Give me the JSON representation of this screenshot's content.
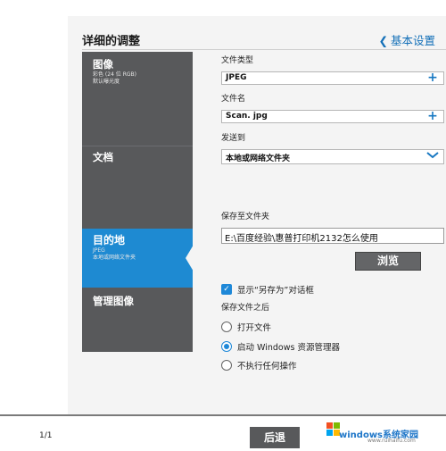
{
  "header": {
    "title": "详细的调整",
    "back_label": "基本设置",
    "back_chevron": "❮"
  },
  "sidebar": {
    "items": [
      {
        "title": "图像",
        "sub1": "彩色 (24 位 RGB)",
        "sub2": "默认曝光度"
      },
      {
        "title": "文档",
        "sub1": "",
        "sub2": ""
      },
      {
        "title": "目的地",
        "sub1": "JPEG",
        "sub2": "本地或网络文件夹"
      },
      {
        "title": "管理图像",
        "sub1": "",
        "sub2": ""
      }
    ],
    "active_index": 2
  },
  "form": {
    "file_type_label": "文件类型",
    "file_type_value": "JPEG",
    "file_name_label": "文件名",
    "file_name_value": "Scan. jpg",
    "send_to_label": "发送到",
    "send_to_value": "本地或网络文件夹",
    "save_folder_label": "保存至文件夹",
    "save_folder_path": "E:\\百度经验\\惠普打印机2132怎么使用",
    "browse_label": "浏览",
    "show_save_as_label": "显示“另存为”对话框",
    "show_save_as_checked": true,
    "after_save_label": "保存文件之后",
    "options": [
      "打开文件",
      "启动 Windows 资源管理器",
      "不执行任何操作"
    ],
    "selected_option": 1
  },
  "footer": {
    "page": "1/1",
    "back_button": "后退"
  },
  "watermark": {
    "brand": "windows系统家园",
    "url": "www.ruihaifu.com"
  },
  "colors": {
    "accent": "#1e8ad2",
    "sidebar": "#58595b",
    "link": "#1470b8"
  }
}
